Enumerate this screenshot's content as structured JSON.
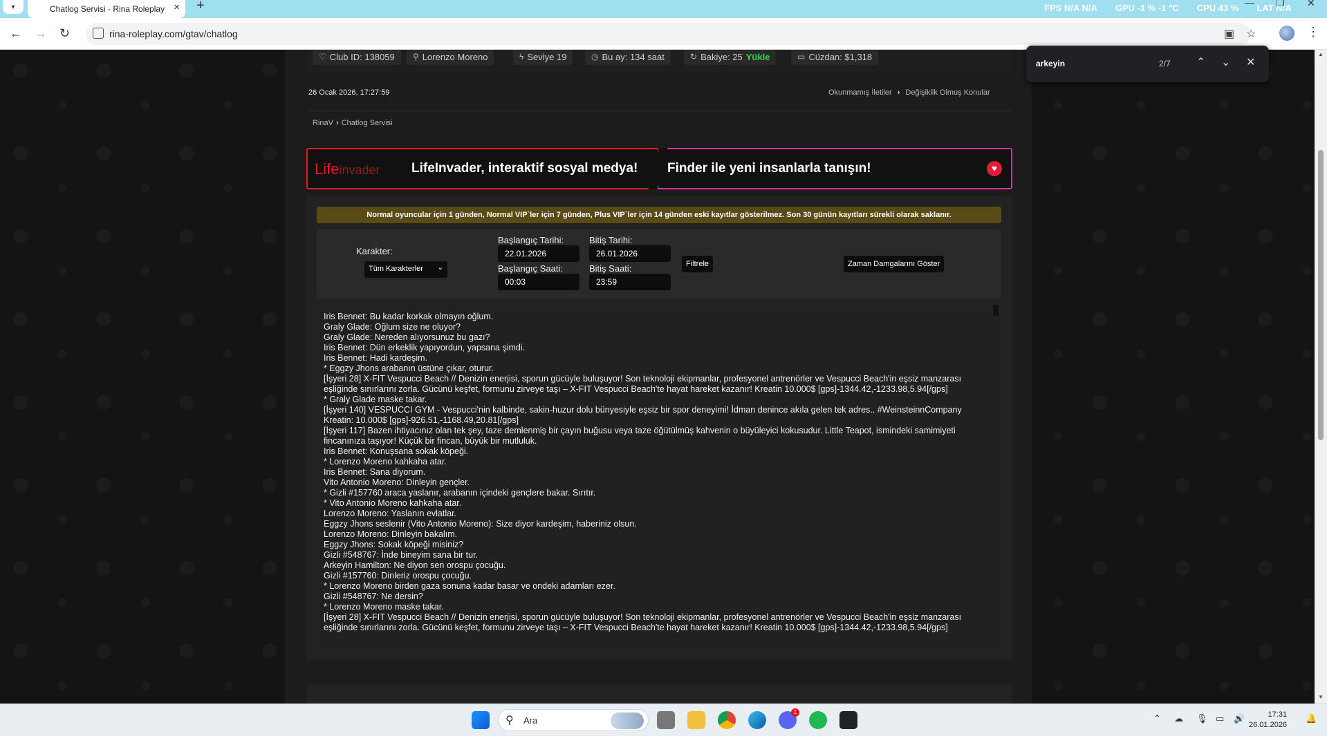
{
  "browser": {
    "tab_title": "Chatlog Servisi - Rina Roleplay",
    "url": "rina-roleplay.com/gtav/chatlog",
    "overlay": {
      "fps": "FPS",
      "fps_val": "N/A",
      "fps_val2": "N/A",
      "gpu": "GPU",
      "gpu_val": "-1 % -1 °C",
      "cpu": "CPU",
      "cpu_val": "43 %",
      "lat": "LAT",
      "lat_val": "N/A"
    },
    "find": {
      "query": "arkeyin",
      "count": "2/7"
    }
  },
  "info_bar": {
    "club": "Club ID: 138059",
    "name": "Lorenzo Moreno",
    "level": "Seviye 19",
    "month": "Bu ay: 134 saat",
    "balance": "Bakiye: 25",
    "balance_action": "Yükle",
    "wallet": "Cüzdan: $1,318"
  },
  "header": {
    "date": "26 Ocak 2026, 17:27:59",
    "link1": "Okunmamış İletiler",
    "link2": "Değişiklik Olmuş Konular",
    "crumb1": "RinaV",
    "crumb2": "Chatlog Servisi"
  },
  "banner": {
    "logo_life": "Life",
    "logo_invader": "invader",
    "text_left": "LifeInvader, interaktif sosyal medya!",
    "text_right": "Finder ile yeni insanlarla tanışın!"
  },
  "notice": "Normal oyuncular için 1 günden, Normal VIP`ler için 7 günden, Plus VIP`ler için 14 günden eski kayıtlar gösterilmez. Son 30 günün kayıtları sürekli olarak saklanır.",
  "filters": {
    "character_label": "Karakter:",
    "character_value": "Tüm Karakterler",
    "start_date_label": "Başlangıç Tarihi:",
    "start_date": "22.01.2026",
    "end_date_label": "Bitiş Tarihi:",
    "end_date": "26.01.2026",
    "start_time_label": "Başlangıç Saati:",
    "start_time": "00:03",
    "end_time_label": "Bitiş Saati:",
    "end_time": "23:59",
    "filter_btn": "Filtrele",
    "timestamps_btn": "Zaman Damgalarını Göster"
  },
  "log": [
    "Iris Bennet: Bu kadar korkak olmayın oğlum.",
    "Graly Glade: Oğlum size ne oluyor?",
    "Graly Glade: Nereden alıyorsunuz bu gazı?",
    "Iris Bennet: Dün erkeklik yapıyordun, yapsana şimdi.",
    "Iris Bennet: Hadi kardeşim.",
    "* Eggzy Jhons arabanın üstüne çıkar, oturur.",
    "[İşyeri 28] X-FIT Vespucci Beach // Denizin enerjisi, sporun gücüyle buluşuyor! Son teknoloji ekipmanlar, profesyonel antrenörler ve Vespucci Beach'in eşsiz manzarası eşliğinde sınırlarını zorla. Gücünü keşfet, formunu zirveye taşı – X-FIT Vespucci Beach'te hayat hareket kazanır! Kreatin 10.000$ [gps]-1344.42,-1233.98,5.94[/gps]",
    "* Graly Glade maske takar.",
    "[İşyeri 140] VESPUCCI GYM - Vespucci'nin kalbinde, sakin-huzur dolu bünyesiyle eşsiz bir spor deneyimi! İdman denince akıla gelen tek adres.. #WeinsteinnCompany Kreatin: 10.000$ [gps]-926.51,-1168.49,20.81[/gps]",
    "[İşyeri 117] Bazen ihtiyacınız olan tek şey, taze demlenmiş bir çayın buğusu veya taze öğütülmüş kahvenin o büyüleyici kokusudur. Little Teapot, ismindeki samimiyeti fincanınıza taşıyor! Küçük bir fincan, büyük bir mutluluk.",
    "Iris Bennet: Konuşsana sokak köpeği.",
    "* Lorenzo Moreno kahkaha atar.",
    "Iris Bennet: Sana diyorum.",
    "Vito Antonio Moreno: Dinleyin gençler.",
    "* Gizli #157760 araca yaslanır, arabanın içindeki gençlere bakar. Sırıtır.",
    "* Vito Antonio Moreno kahkaha atar.",
    "Lorenzo Moreno: Yaslanın evlatlar.",
    "Eggzy Jhons seslenir (Vito Antonio Moreno): Size diyor kardeşim, haberiniz olsun.",
    "Lorenzo Moreno: Dinleyin bakalım.",
    "Eggzy Jhons: Sokak köpeği misiniz?",
    "Gizli #548767: İnde bineyim sana bir tur.",
    "Arkeyin Hamilton: Ne diyon sen orospu çocuğu.",
    "Gizli #157760: Dinleriz orospu çocuğu.",
    "* Lorenzo Moreno birden gaza sonuna kadar basar ve ondeki adamları ezer.",
    "Gizli #548767: Ne dersin?",
    "* Lorenzo Moreno maske takar.",
    "[İşyeri 28] X-FIT Vespucci Beach // Denizin enerjisi, sporun gücüyle buluşuyor! Son teknoloji ekipmanlar, profesyonel antrenörler ve Vespucci Beach'in eşsiz manzarası eşliğinde sınırlarını zorla. Gücünü keşfet, formunu zirveye taşı – X-FIT Vespucci Beach'te hayat hareket kazanır! Kreatin 10.000$ [gps]-1344.42,-1233.98,5.94[/gps]"
  ],
  "taskbar": {
    "search_placeholder": "Ara",
    "time": "17:31",
    "date": "26.01.2026",
    "discord_badge": "1"
  }
}
